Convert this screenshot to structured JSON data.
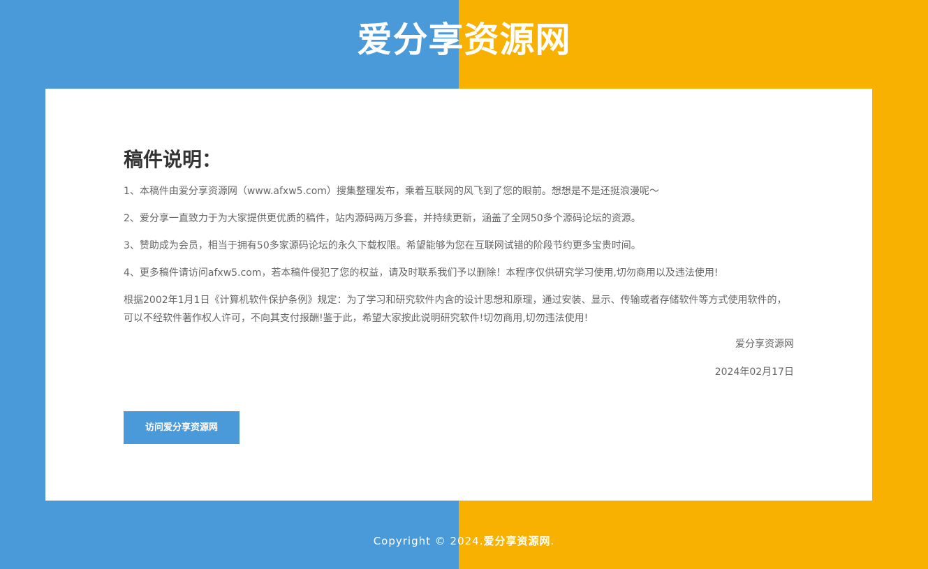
{
  "header": {
    "site_title": "爱分享资源网"
  },
  "notice": {
    "title": "稿件说明：",
    "items": [
      "1、本稿件由爱分享资源网（www.afxw5.com）搜集整理发布，乘着互联网的风飞到了您的眼前。想想是不是还挺浪漫呢～",
      "2、爱分享一直致力于为大家提供更优质的稿件，站内源码两万多套，并持续更新，涵盖了全网50多个源码论坛的资源。",
      "3、赞助成为会员，相当于拥有50多家源码论坛的永久下载权限。希望能够为您在互联网试错的阶段节约更多宝贵时间。",
      "4、更多稿件请访问afxw5.com，若本稿件侵犯了您的权益，请及时联系我们予以删除！本程序仅供研究学习使用,切勿商用以及违法使用!"
    ],
    "legal": "根据2002年1月1日《计算机软件保护条例》规定：为了学习和研究软件内含的设计思想和原理，通过安装、显示、传输或者存储软件等方式使用软件的，可以不经软件著作权人许可，不向其支付报酬!鉴于此，希望大家按此说明研究软件!切勿商用,切勿违法使用!",
    "signature": "爱分享资源网",
    "date": "2024年02月17日",
    "button_label": "访问爱分享资源网"
  },
  "footer": {
    "prefix": "Copyright © 2024.",
    "link_text": "爱分享资源网",
    "suffix": "."
  },
  "colors": {
    "left_background": "#4a9ada",
    "right_background": "#f8b100",
    "card_background": "#ffffff",
    "button_background": "#4a9ada"
  }
}
